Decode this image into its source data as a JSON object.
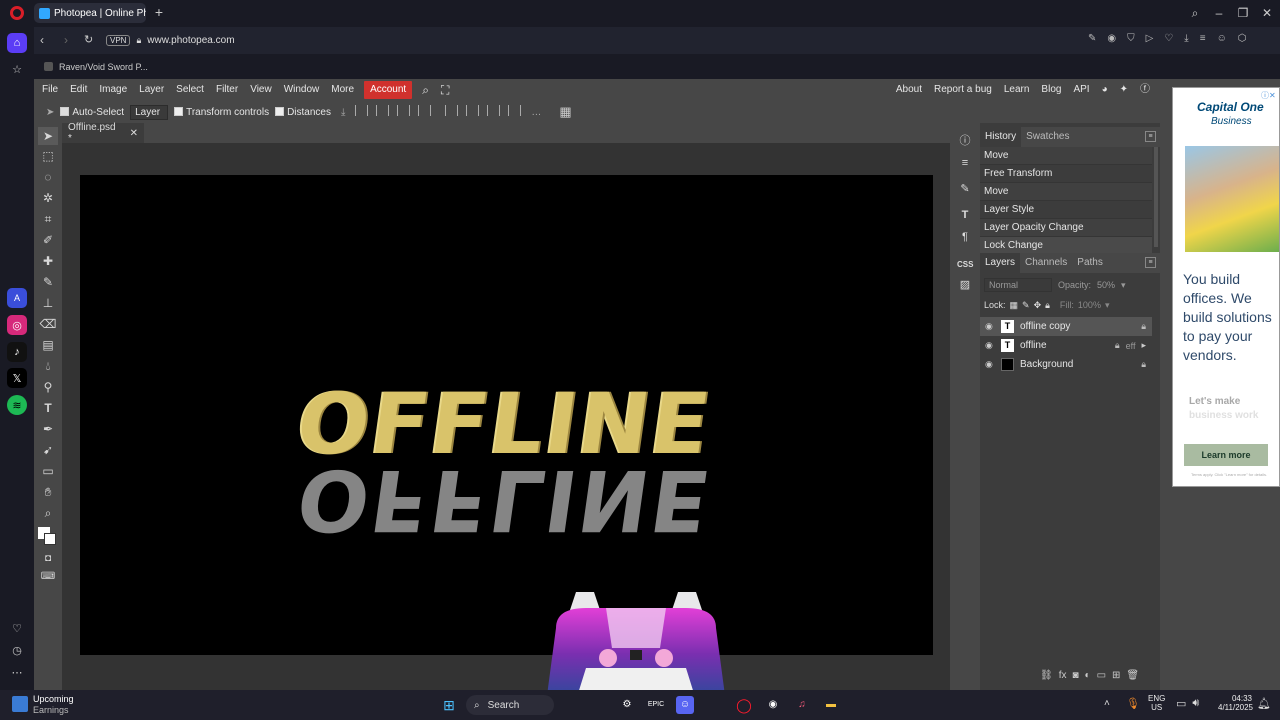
{
  "browser": {
    "tab_title": "Photopea | Online Photo E",
    "url": "www.photopea.com",
    "vpn_label": "VPN",
    "bookmark": "Raven/Void Sword P..."
  },
  "photopea": {
    "menu": [
      "File",
      "Edit",
      "Image",
      "Layer",
      "Select",
      "Filter",
      "View",
      "Window",
      "More"
    ],
    "account_label": "Account",
    "right_menu": [
      "About",
      "Report a bug",
      "Learn",
      "Blog",
      "API"
    ],
    "options": {
      "auto_select": "Auto-Select",
      "layer_select": "Layer",
      "transform_controls": "Transform controls",
      "distances": "Distances"
    },
    "doc_tab": "Offline.psd *",
    "canvas_text": "OFFLINE",
    "history": {
      "tabs": [
        "History",
        "Swatches"
      ],
      "items": [
        "Move",
        "Free Transform",
        "Move",
        "Layer Style",
        "Layer Opacity Change",
        "Lock Change"
      ]
    },
    "layers_panel": {
      "tabs": [
        "Layers",
        "Channels",
        "Paths"
      ],
      "blend_mode": "Normal",
      "opacity_label": "Opacity:",
      "opacity_value": "50%",
      "lock_label": "Lock:",
      "fill_label": "Fill:",
      "fill_value": "100%",
      "layers": [
        {
          "name": "offline copy",
          "type": "T"
        },
        {
          "name": "offline",
          "type": "T",
          "fx": "eff"
        },
        {
          "name": "Background",
          "type": ""
        }
      ]
    },
    "ad": {
      "brand": "Capital One",
      "brand_sub": "Business",
      "headline": "You build offices. We build solutions to pay your vendors.",
      "subline": "Let's make",
      "subline2": "business work",
      "cta": "Learn more",
      "fine_print": "Terms apply. Click \"Learn more\" for details."
    }
  },
  "taskbar": {
    "widget_title": "Upcoming",
    "widget_sub": "Earnings",
    "search_label": "Search",
    "lang": "ENG",
    "region": "US",
    "time": "04:33",
    "date": "4/11/2025"
  }
}
